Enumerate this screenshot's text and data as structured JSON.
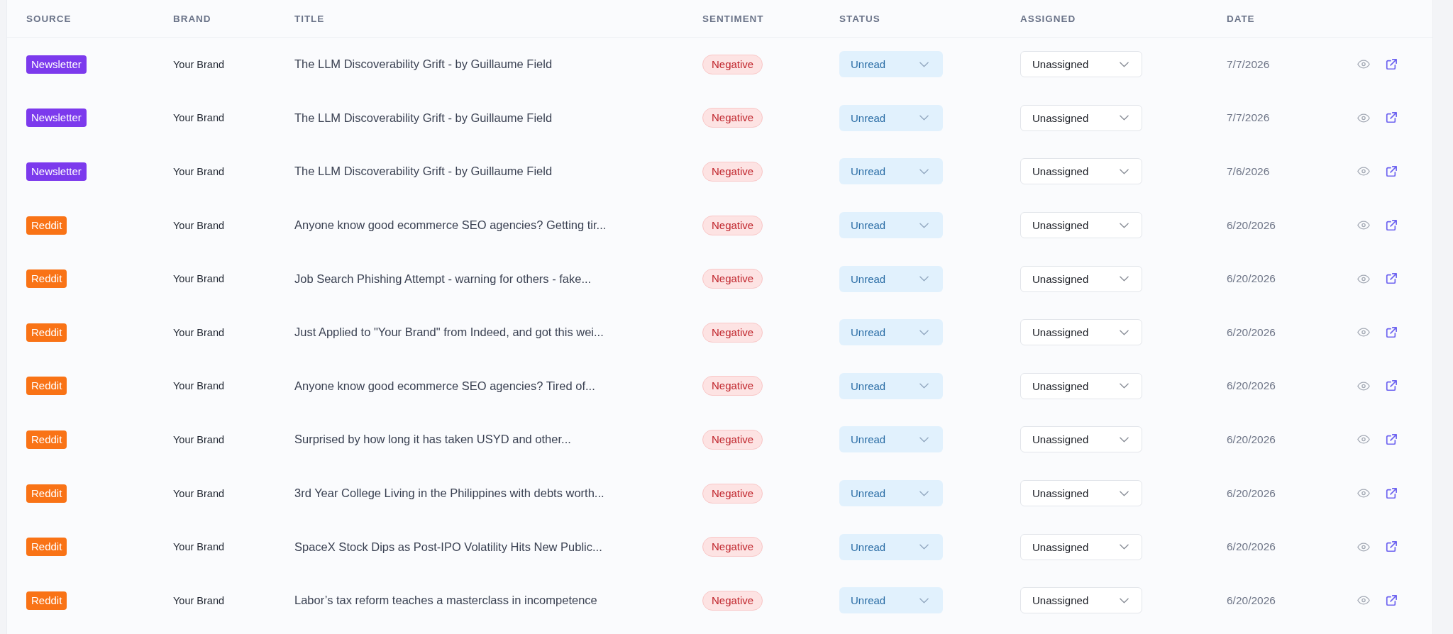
{
  "table": {
    "columns": [
      "SOURCE",
      "BRAND",
      "TITLE",
      "SENTIMENT",
      "STATUS",
      "ASSIGNED",
      "DATE"
    ],
    "rows": [
      {
        "source": {
          "label": "Newsletter",
          "color": "#7c3aed"
        },
        "brand": "Your Brand",
        "title": "The LLM Discoverability Grift - by Guillaume Field",
        "sentiment": "Negative",
        "status": "Unread",
        "assigned": "Unassigned",
        "date": "7/7/2026"
      },
      {
        "source": {
          "label": "Newsletter",
          "color": "#7c3aed"
        },
        "brand": "Your Brand",
        "title": "The LLM Discoverability Grift - by Guillaume Field",
        "sentiment": "Negative",
        "status": "Unread",
        "assigned": "Unassigned",
        "date": "7/7/2026"
      },
      {
        "source": {
          "label": "Newsletter",
          "color": "#7c3aed"
        },
        "brand": "Your Brand",
        "title": "The LLM Discoverability Grift - by Guillaume Field",
        "sentiment": "Negative",
        "status": "Unread",
        "assigned": "Unassigned",
        "date": "7/6/2026"
      },
      {
        "source": {
          "label": "Reddit",
          "color": "#f97316"
        },
        "brand": "Your Brand",
        "title": "Anyone know good ecommerce SEO agencies? Getting tir...",
        "sentiment": "Negative",
        "status": "Unread",
        "assigned": "Unassigned",
        "date": "6/20/2026"
      },
      {
        "source": {
          "label": "Reddit",
          "color": "#f97316"
        },
        "brand": "Your Brand",
        "title": "Job Search Phishing Attempt - warning for others - fake...",
        "sentiment": "Negative",
        "status": "Unread",
        "assigned": "Unassigned",
        "date": "6/20/2026"
      },
      {
        "source": {
          "label": "Reddit",
          "color": "#f97316"
        },
        "brand": "Your Brand",
        "title": "Just Applied to \"Your Brand\" from Indeed, and got this wei...",
        "sentiment": "Negative",
        "status": "Unread",
        "assigned": "Unassigned",
        "date": "6/20/2026"
      },
      {
        "source": {
          "label": "Reddit",
          "color": "#f97316"
        },
        "brand": "Your Brand",
        "title": "Anyone know good ecommerce SEO agencies? Tired of...",
        "sentiment": "Negative",
        "status": "Unread",
        "assigned": "Unassigned",
        "date": "6/20/2026"
      },
      {
        "source": {
          "label": "Reddit",
          "color": "#f97316"
        },
        "brand": "Your Brand",
        "title": "Surprised by how long it has taken USYD and other...",
        "sentiment": "Negative",
        "status": "Unread",
        "assigned": "Unassigned",
        "date": "6/20/2026"
      },
      {
        "source": {
          "label": "Reddit",
          "color": "#f97316"
        },
        "brand": "Your Brand",
        "title": "3rd Year College Living in the Philippines with debts worth...",
        "sentiment": "Negative",
        "status": "Unread",
        "assigned": "Unassigned",
        "date": "6/20/2026"
      },
      {
        "source": {
          "label": "Reddit",
          "color": "#f97316"
        },
        "brand": "Your Brand",
        "title": "SpaceX Stock Dips as Post-IPO Volatility Hits New Public...",
        "sentiment": "Negative",
        "status": "Unread",
        "assigned": "Unassigned",
        "date": "6/20/2026"
      },
      {
        "source": {
          "label": "Reddit",
          "color": "#f97316"
        },
        "brand": "Your Brand",
        "title": "Labor’s tax reform teaches a masterclass in incompetence",
        "sentiment": "Negative",
        "status": "Unread",
        "assigned": "Unassigned",
        "date": "6/20/2026"
      }
    ]
  }
}
